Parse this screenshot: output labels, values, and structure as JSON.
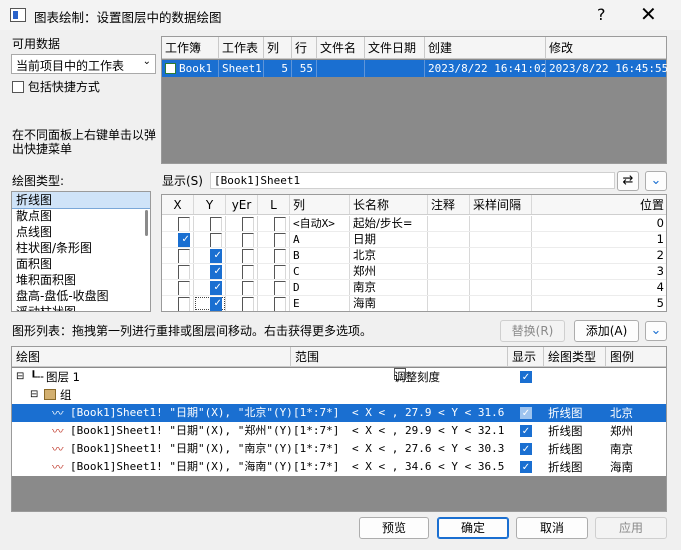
{
  "window": {
    "title": "图表绘制：设置图层中的数据绘图",
    "help": "?",
    "close": "✕"
  },
  "data_source": {
    "label": "可用数据",
    "combo_value": "当前项目中的工作表",
    "shortcut_label": "包括快捷方式",
    "hint": "在不同面板上右键单击以弹出快捷菜单"
  },
  "workbook_table": {
    "headers": [
      "工作簿",
      "工作表",
      "列",
      "行",
      "文件名",
      "文件日期",
      "创建",
      "修改"
    ],
    "row": [
      "Book1",
      "Sheet1",
      "5",
      "55",
      "",
      "",
      "2023/8/22 16:41:02",
      "2023/8/22 16:45:55"
    ]
  },
  "plot_type": {
    "label": "绘图类型:",
    "items": [
      "折线图",
      "散点图",
      "点线图",
      "柱状图/条形图",
      "面积图",
      "堆积面积图",
      "盘高-盘低-收盘图",
      "浮动柱状图"
    ]
  },
  "columns": {
    "show_label": "显示(S)",
    "sheet_label": "[Book1]Sheet1",
    "headers": [
      "X",
      "Y",
      "yEr",
      "L",
      "列",
      "长名称",
      "注释",
      "采样间隔",
      "位置"
    ],
    "rows": [
      {
        "col": "<自动X>",
        "long": "起始/步长=",
        "pos": "0"
      },
      {
        "col": "A",
        "long": "日期",
        "pos": "1"
      },
      {
        "col": "B",
        "long": "北京",
        "pos": "2"
      },
      {
        "col": "C",
        "long": "郑州",
        "pos": "3"
      },
      {
        "col": "D",
        "long": "南京",
        "pos": "4"
      },
      {
        "col": "E",
        "long": "海南",
        "pos": "5"
      }
    ]
  },
  "plot_list": {
    "label": "图形列表：拖拽第一列进行重排或图层间移动。右击获得更多选项。",
    "replace": "替换(R)",
    "add": "添加(A)"
  },
  "layer_tree": {
    "headers": [
      "绘图",
      "范围",
      "显示",
      "绘图类型",
      "图例"
    ],
    "layer_label": "图层 1",
    "rescale_label": "调整刻度",
    "group_label": "组",
    "plots": [
      {
        "name": "[Book1]Sheet1! \"日期\"(X), \"北京\"(Y)",
        "range": "[1*:7*]",
        "cond": "< X <  , 27.9 < Y < 31.6",
        "type": "折线图",
        "legend": "北京"
      },
      {
        "name": "[Book1]Sheet1! \"日期\"(X), \"郑州\"(Y)",
        "range": "[1*:7*]",
        "cond": "< X <  , 29.9 < Y < 32.1",
        "type": "折线图",
        "legend": "郑州"
      },
      {
        "name": "[Book1]Sheet1! \"日期\"(X), \"南京\"(Y)",
        "range": "[1*:7*]",
        "cond": "< X <  , 27.6 < Y < 30.3",
        "type": "折线图",
        "legend": "南京"
      },
      {
        "name": "[Book1]Sheet1! \"日期\"(X), \"海南\"(Y)",
        "range": "[1*:7*]",
        "cond": "< X <  , 34.6 < Y < 36.5",
        "type": "折线图",
        "legend": "海南"
      }
    ]
  },
  "footer": {
    "preview": "预览",
    "ok": "确定",
    "cancel": "取消",
    "apply": "应用"
  },
  "colors": {
    "accent": "#1a6fd1"
  }
}
